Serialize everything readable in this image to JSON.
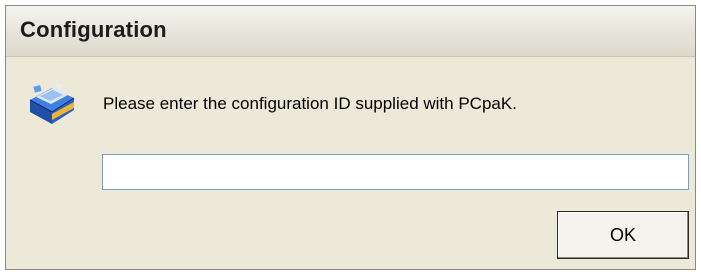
{
  "dialog": {
    "title": "Configuration",
    "icon": "pcpak-app-icon",
    "message": "Please enter the configuration ID supplied with PCpaK.",
    "input": {
      "value": "",
      "placeholder": ""
    },
    "ok_label": "OK"
  }
}
